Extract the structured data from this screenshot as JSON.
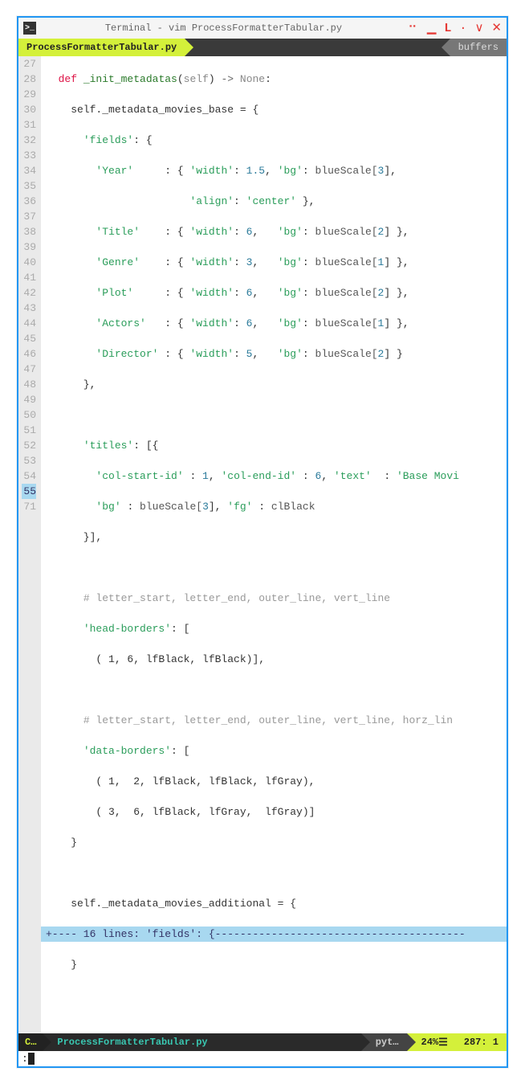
{
  "window": {
    "title": "Terminal - vim ProcessFormatterTabular.py"
  },
  "tabline": {
    "active_tab": "ProcessFormatterTabular.py",
    "buffers_label": "buffers"
  },
  "gutter": [
    "27",
    "28",
    "29",
    "30",
    "31",
    "32",
    "33",
    "34",
    "35",
    "36",
    "37",
    "38",
    "39",
    "40",
    "41",
    "42",
    "43",
    "44",
    "45",
    "46",
    "47",
    "48",
    "49",
    "50",
    "51",
    "52",
    "53",
    "54",
    "55",
    "71",
    ""
  ],
  "code": {
    "l27_def": "def",
    "l27_name": "_init_metadatas",
    "l27_self": "self",
    "l27_arrow": "-> ",
    "l27_none": "None",
    "l28": "    self._metadata_movies_base = {",
    "l29_k": "'fields'",
    "l29_r": ": {",
    "l30_k": "'Year'",
    "l30_w": "'width'",
    "l30_wv": "1.5",
    "l30_bg": "'bg'",
    "l30_bv": "blueScale[",
    "l30_bi": "3",
    "l31_a": "'align'",
    "l31_av": "'center'",
    "l32_k": "'Title'",
    "l32_wv": "6",
    "l32_bi": "2",
    "l33_k": "'Genre'",
    "l33_wv": "3",
    "l33_bi": "1",
    "l34_k": "'Plot'",
    "l34_wv": "6",
    "l34_bi": "2",
    "l35_k": "'Actors'",
    "l35_wv": "6",
    "l35_bi": "1",
    "l36_k": "'Director'",
    "l36_wv": "5",
    "l36_bi": "2",
    "l37": "      },",
    "l39_k": "'titles'",
    "l39_r": ": [{",
    "l40_cs": "'col-start-id'",
    "l40_csv": "1",
    "l40_ce": "'col-end-id'",
    "l40_cev": "6",
    "l40_t": "'text'",
    "l40_tv": "'Base Movi",
    "l41_bg": "'bg'",
    "l41_bv": "blueScale[",
    "l41_bi": "3",
    "l41_fg": "'fg'",
    "l41_fv": "clBlack",
    "l42": "      }],",
    "l44_c": "# letter_start, letter_end, outer_line, vert_line",
    "l45_k": "'head-borders'",
    "l45_r": ": [",
    "l46": "        ( 1, 6, lfBlack, lfBlack)],",
    "l48_c": "# letter_start, letter_end, outer_line, vert_line, horz_lin",
    "l49_k": "'data-borders'",
    "l49_r": ": [",
    "l50": "        ( 1,  2, lfBlack, lfBlack, lfGray),",
    "l51": "        ( 3,  6, lfBlack, lfGray,  lfGray)]",
    "l52": "    }",
    "l54": "    self._metadata_movies_additional = {",
    "l55_fold": "+---- 16 lines: 'fields': {----------------------------------------",
    "l71": "    }"
  },
  "statusline": {
    "mode": "C…",
    "filename": "ProcessFormatterTabular.py",
    "filetype": "pyt…",
    "percent": "24%",
    "position": "287: 1"
  },
  "cmdline": {
    "prompt": ":"
  }
}
